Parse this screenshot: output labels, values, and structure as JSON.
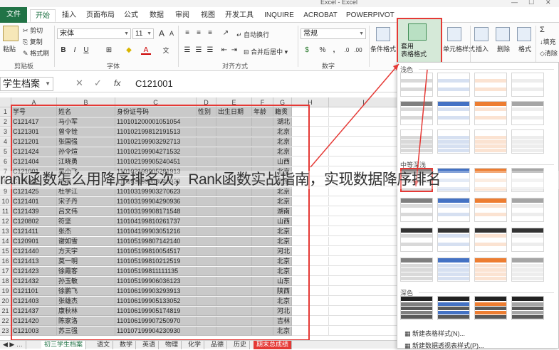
{
  "window": {
    "title": "Excel - Excel"
  },
  "tabs": [
    "文件",
    "开始",
    "插入",
    "页面布局",
    "公式",
    "数据",
    "审阅",
    "视图",
    "开发工具",
    "INQUIRE",
    "ACROBAT",
    "POWERPIVOT"
  ],
  "ribbon": {
    "paste": "粘贴",
    "cut": "剪切",
    "copy": "复制",
    "format_painter": "格式刷",
    "clipboard_label": "剪贴板",
    "font_name": "宋体",
    "font_size": "11",
    "font_label": "字体",
    "wrap_text": "自动换行",
    "merge_center": "合并后居中",
    "align_label": "对齐方式",
    "number_format": "常规",
    "number_label": "数字",
    "percent": "%",
    "comma": ",",
    "cond_format": "条件格式",
    "table_format": "套用\n表格格式",
    "cell_style": "单元格样式",
    "insert": "插入",
    "delete": "删除",
    "format": "格式",
    "fill": "填充",
    "clear": "清除",
    "bold": "B",
    "italic": "I",
    "underline": "U",
    "font_color_letter": "A",
    "sum": "Σ"
  },
  "formula_bar": {
    "name_box": "学生档案",
    "fx": "fx",
    "value": "C121001",
    "cancel": "✕",
    "enter": "✓"
  },
  "columns": [
    "A",
    "B",
    "C",
    "D",
    "E",
    "F",
    "G",
    "H",
    "I"
  ],
  "header_row": [
    "学号",
    "姓名",
    "身份证号码",
    "性别",
    "出生日期",
    "年龄",
    "籍贯"
  ],
  "rows": [
    [
      "C121417",
      "马小军",
      "110101200001051054",
      "湖北"
    ],
    [
      "C121301",
      "曾令铨",
      "110102199812191513",
      "北京"
    ],
    [
      "C121201",
      "张国强",
      "110102199903292713",
      "北京"
    ],
    [
      "C121424",
      "孙令煊",
      "110102199904271532",
      "北京"
    ],
    [
      "C121404",
      "江晓勇",
      "110102199905240451",
      "山西"
    ],
    [
      "C121001",
      "吴小飞",
      "110102199905281913",
      "北京"
    ],
    [
      "C121422",
      "姚南",
      "110103199903040920",
      "北京"
    ],
    [
      "C121425",
      "杜学江",
      "110103199903270623",
      "北京"
    ],
    [
      "C121401",
      "宋子丹",
      "110103199904290936",
      "北京"
    ],
    [
      "C121439",
      "吕文伟",
      "110103199908171548",
      "湖南"
    ],
    [
      "C120802",
      "符坚",
      "110104199810261737",
      "山西"
    ],
    [
      "C121411",
      "张杰",
      "110104199903051216",
      "北京"
    ],
    [
      "C120901",
      "谢如雪",
      "110105199807142140",
      "北京"
    ],
    [
      "C121440",
      "方天宇",
      "110105199810054517",
      "河北"
    ],
    [
      "C121413",
      "莫一明",
      "110105199810212519",
      "北京"
    ],
    [
      "C121423",
      "徐霞客",
      "110105199811111135",
      "北京"
    ],
    [
      "C121432",
      "孙玉敏",
      "110105199906036123",
      "山东"
    ],
    [
      "C121101",
      "徐鹏飞",
      "110106199903293913",
      "陕西"
    ],
    [
      "C121403",
      "张雄杰",
      "110106199905133052",
      "北京"
    ],
    [
      "C121437",
      "康秋林",
      "110106199905174819",
      "河北"
    ],
    [
      "C121420",
      "陈家洛",
      "110106199907250970",
      "吉林"
    ],
    [
      "C121003",
      "苏三强",
      "110107199904230930",
      "北京"
    ]
  ],
  "sheet_tabs": [
    "初三学生档案",
    "语文",
    "数学",
    "英语",
    "物理",
    "化学",
    "品德",
    "历史",
    "期末总成绩"
  ],
  "gallery": {
    "light": "浅色",
    "medium": "中等深浅",
    "dark": "深色",
    "new_table_style": "新建表格样式(N)...",
    "new_pivot_style": "新建数据透视表样式(P)..."
  },
  "caption": "rank函数怎么用降序排名次，Rank函数实战指南，实现数据降序排名",
  "colors": {
    "excel_green": "#217346",
    "highlight_red": "#e53935",
    "selection_gray": "#c9c9c9"
  }
}
